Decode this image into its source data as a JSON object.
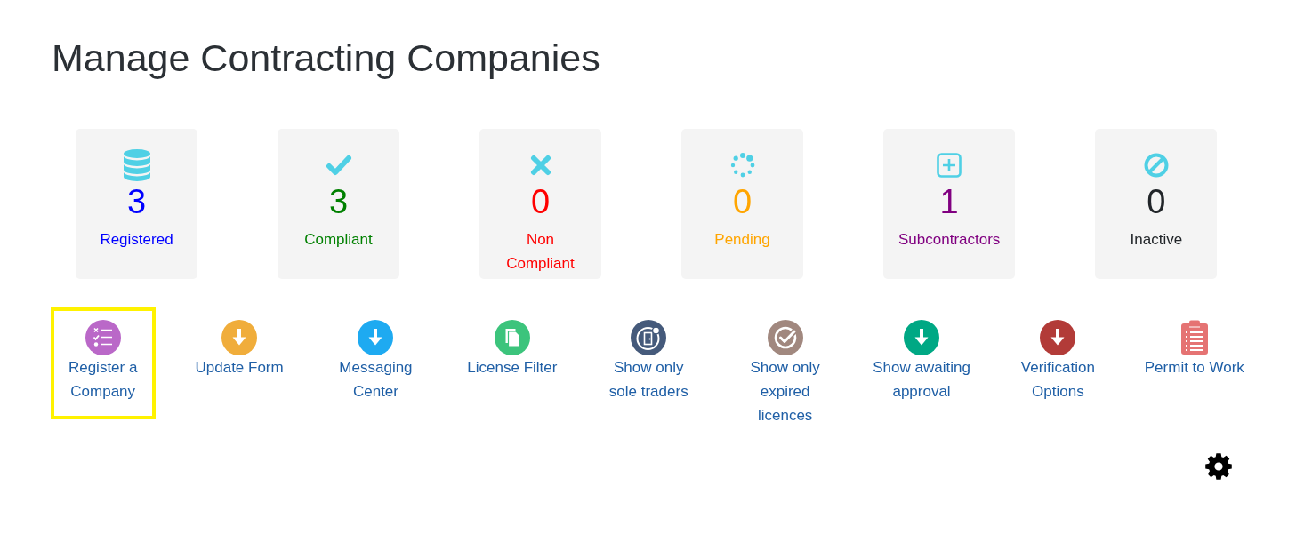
{
  "title": "Manage Contracting Companies",
  "stats": [
    {
      "count": "3",
      "label": "Registered",
      "color": "#0000ff"
    },
    {
      "count": "3",
      "label": "Compliant",
      "color": "#008000"
    },
    {
      "count": "0",
      "label": "Non\nCompliant",
      "color": "#ff0000"
    },
    {
      "count": "0",
      "label": "Pending",
      "color": "#ffa500"
    },
    {
      "count": "1",
      "label": "Subcontractors",
      "color": "#800080"
    },
    {
      "count": "0",
      "label": "Inactive",
      "color": "#212529"
    }
  ],
  "actions": [
    {
      "label": "Register a\nCompany",
      "selected": true,
      "color": "#ba68c8"
    },
    {
      "label": "Update Form",
      "selected": false,
      "color": "#f0ad3b"
    },
    {
      "label": "Messaging\nCenter",
      "selected": false,
      "color": "#1eaaf1"
    },
    {
      "label": "License Filter",
      "selected": false,
      "color": "#3cc47c"
    },
    {
      "label": "Show only\nsole traders",
      "selected": false,
      "color": "#455a7b"
    },
    {
      "label": "Show only\nexpired\nlicences",
      "selected": false,
      "color": "#a1887f"
    },
    {
      "label": "Show awaiting\napproval",
      "selected": false,
      "color": "#00a884"
    },
    {
      "label": "Verification\nOptions",
      "selected": false,
      "color": "#b23b38"
    },
    {
      "label": "Permit to Work",
      "selected": false,
      "color": "#e57373"
    }
  ]
}
